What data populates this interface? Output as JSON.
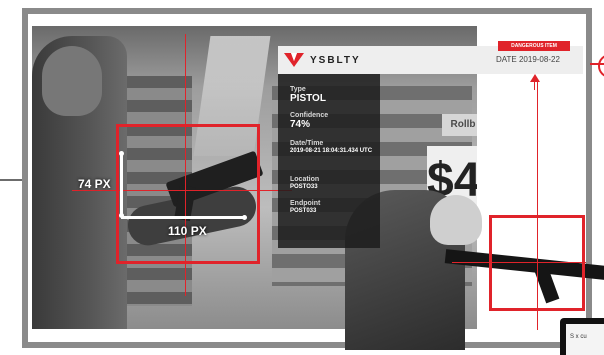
{
  "header": {
    "brand": "YSBLTY",
    "logo_icon": "v-logo-icon",
    "date": "DATE 2019-08-22",
    "alert_tag": "DANGEROUS ITEM"
  },
  "detection": {
    "fields": [
      {
        "label": "Type",
        "value": "PISTOL"
      },
      {
        "label": "Confidence",
        "value": "74%"
      },
      {
        "label": "Date/Time",
        "value": "2019-08-21 18:04:31.434 UTC"
      },
      {
        "label": "Location",
        "value": "POSTO33"
      },
      {
        "label": "Endpoint",
        "value": "POST033"
      }
    ]
  },
  "measurements": {
    "height": "74 PX",
    "width": "110 PX"
  },
  "scene": {
    "price_sign": "$4",
    "price_label": "Rollb"
  },
  "device": {
    "screen_text": "S x cu"
  },
  "colors": {
    "accent": "#e0232a",
    "panel": "#1c1c1c",
    "frame": "#8a8a8a"
  }
}
